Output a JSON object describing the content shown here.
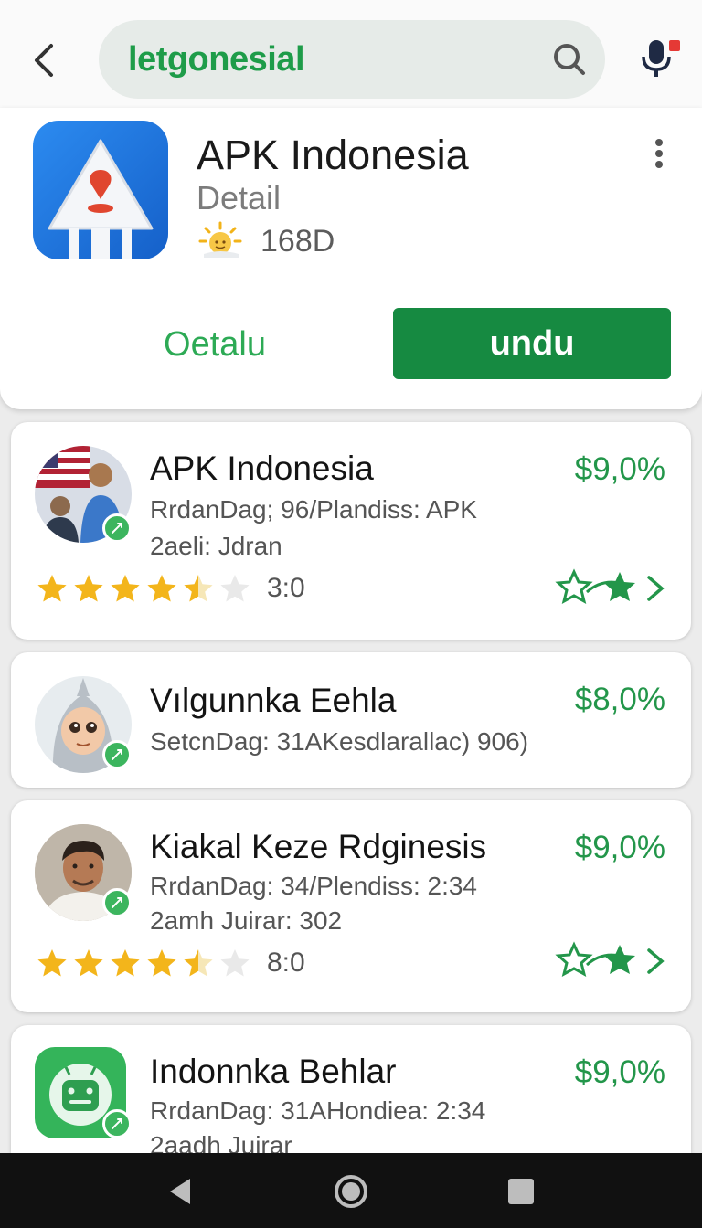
{
  "search": {
    "value": "letgonesial"
  },
  "app": {
    "title": "APK Indonesia",
    "subtitle": "Detail",
    "meta_value": "168D",
    "secondary_label": "Oetalu",
    "primary_label": "undu"
  },
  "colors": {
    "accent_green": "#168a41",
    "price_green": "#23964a",
    "star_gold": "#f3b51b"
  },
  "items": [
    {
      "title": "APK Indonesia",
      "line1": "RrdanDag; 96/Plandiss: APK",
      "line2": "2aeli: Jdran",
      "price": "$9,0%",
      "rating": "3:0",
      "stars": 4.5,
      "avatar": "flag-person-avatar"
    },
    {
      "title": "Vılgunnka Eehla",
      "line1": "SetcnDag: 31AKesdlarallac) 906)",
      "price": "$8,0%",
      "avatar": "astronaut-avatar"
    },
    {
      "title": "Kiakal Keze Rdginesis",
      "line1": "RrdanDag: 34/Plendiss: 2:34",
      "line2": "2amh Juirar: 302",
      "price": "$9,0%",
      "rating": "8:0",
      "stars": 4.5,
      "avatar": "man-portrait-avatar"
    },
    {
      "title": "Indonnka Behlar",
      "line1": "RrdanDag: 31AHondiea: 2:34",
      "line2": "2aadh Juirar",
      "price": "$9,0%",
      "avatar": "android-app-avatar"
    }
  ]
}
